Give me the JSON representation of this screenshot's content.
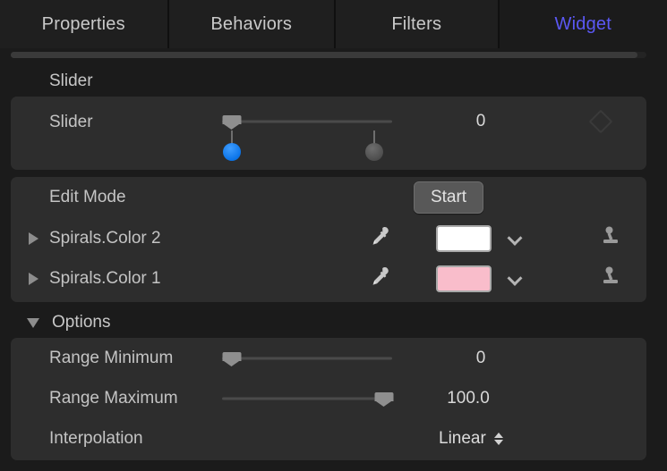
{
  "tabs": [
    {
      "label": "Properties",
      "active": false
    },
    {
      "label": "Behaviors",
      "active": false
    },
    {
      "label": "Filters",
      "active": false
    },
    {
      "label": "Widget",
      "active": true
    }
  ],
  "accent_color": "#5b58f5",
  "groups": {
    "slider_group_label": "Slider",
    "options_group_label": "Options"
  },
  "slider_row": {
    "label": "Slider",
    "value": "0",
    "keyframe_icon": "diamond-icon",
    "min_handle_icon": "range-min-handle",
    "max_handle_icon": "range-max-handle"
  },
  "edit_mode_row": {
    "label": "Edit Mode",
    "button_label": "Start"
  },
  "color_rows": [
    {
      "label": "Spirals.Color 2",
      "swatch_color": "#ffffff",
      "eyedropper_icon": "eyedropper-icon",
      "chevron_icon": "chevron-down-icon",
      "rig_icon": "publish-joystick-icon",
      "disclosure": "collapsed"
    },
    {
      "label": "Spirals.Color 1",
      "swatch_color": "#f9bdcb",
      "eyedropper_icon": "eyedropper-icon",
      "chevron_icon": "chevron-down-icon",
      "rig_icon": "publish-joystick-icon",
      "disclosure": "collapsed"
    }
  ],
  "options_rows": [
    {
      "label": "Range Minimum",
      "value": "0",
      "thumb_pct": 0
    },
    {
      "label": "Range Maximum",
      "value": "100.0",
      "thumb_pct": 100
    },
    {
      "label": "Interpolation",
      "value": "Linear",
      "control": "popup-menu"
    }
  ]
}
